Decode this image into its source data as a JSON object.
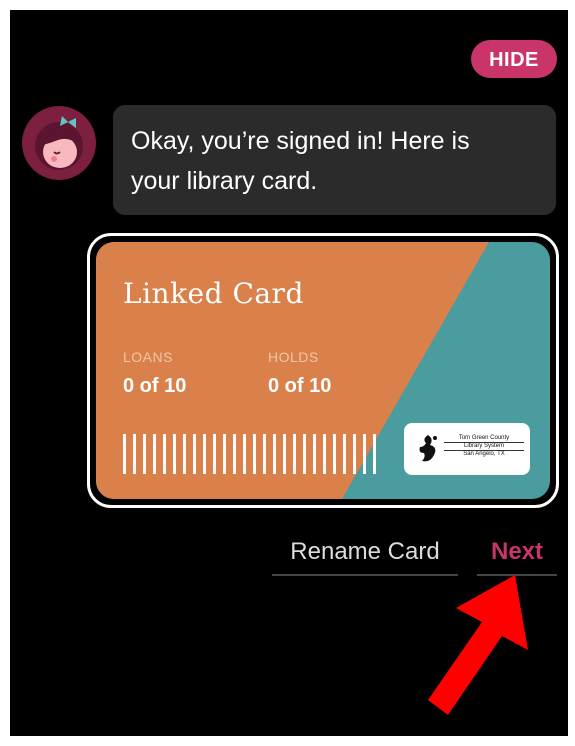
{
  "header": {
    "hide_label": "HIDE"
  },
  "message": {
    "line1": "Okay, you’re signed in! Here is",
    "line2": "your library card."
  },
  "card": {
    "title": "Linked Card",
    "loans_label": "LOANS",
    "loans_value": "0 of 10",
    "holds_label": "HOLDS",
    "holds_value": "0 of 10",
    "library_name_line1": "Tom Green County",
    "library_name_line2": "Library System",
    "library_city": "San Angelo, TX"
  },
  "actions": {
    "rename_label": "Rename Card",
    "next_label": "Next"
  },
  "colors": {
    "accent": "#c9346a",
    "card_orange": "#d9804b",
    "card_teal": "#4a9c9f",
    "bubble": "#2b2b2b",
    "arrow": "#ff0000"
  },
  "icons": {
    "avatar": "libby-avatar-icon",
    "library_logo": "library-logo-icon",
    "pointer": "red-arrow-icon"
  }
}
